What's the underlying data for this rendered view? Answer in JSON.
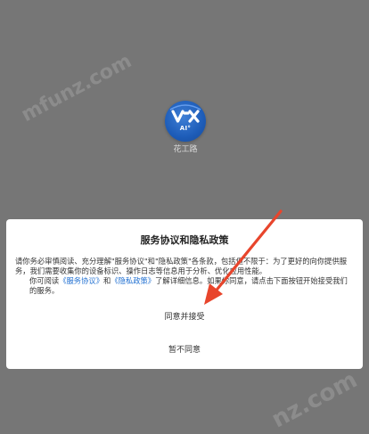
{
  "watermark": {
    "text": "mfunz.com",
    "text_short": "nz.com"
  },
  "app": {
    "logo_sub": "AI°",
    "name": "花工路"
  },
  "dialog": {
    "title": "服务协议和隐私政策",
    "body_line1": "请你务必审慎阅读、充分理解\"服务协议\"和\"隐私政策\"各条款，包括但不限于：为了更好的向你提供服务，我们需要收集你的设备标识、操作日志等信息用于分析、优化应用性能。",
    "body2_prefix": "你可阅读",
    "link_service": "《服务协议》",
    "body2_and": "和",
    "link_privacy": "《隐私政策》",
    "body2_suffix": "了解详细信息。如果你同意，请点击下面按钮开始接受我们的服务。",
    "accept_label": "同意并接受",
    "reject_label": "暂不同意"
  },
  "colors": {
    "overlay": "#767676",
    "link": "#1f6fd1",
    "arrow": "#e8452c"
  },
  "icons": {
    "logo": "vox-ai-logo-icon",
    "arrow": "red-arrow-icon"
  }
}
